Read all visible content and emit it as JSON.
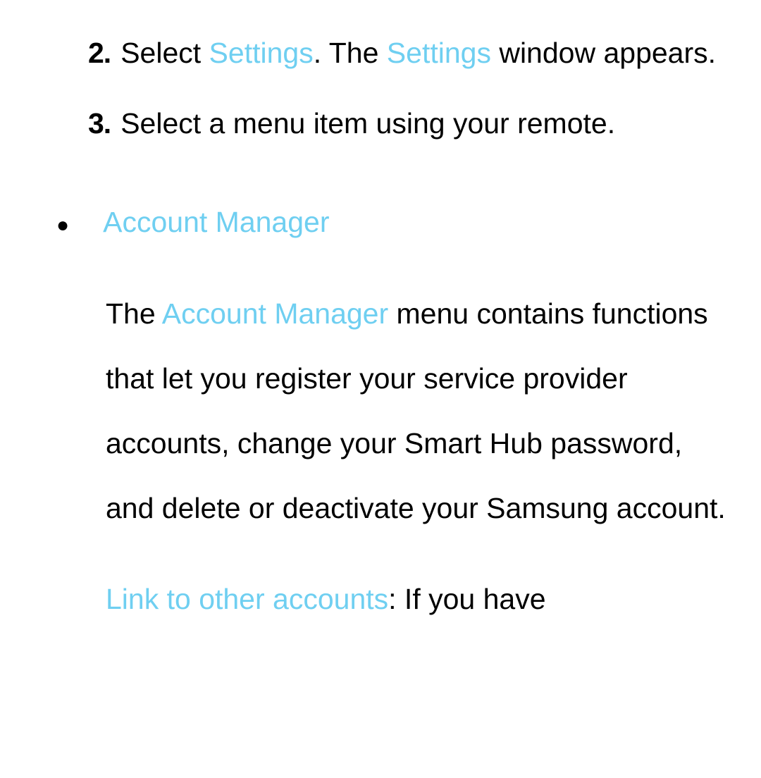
{
  "steps": {
    "item2": {
      "number": "2.",
      "prefix": "Select ",
      "settings1": "Settings",
      "mid": ". The ",
      "settings2": "Settings",
      "suffix": " window appears."
    },
    "item3": {
      "number": "3.",
      "text": "Select a menu item using your remote."
    }
  },
  "section": {
    "bullet": "●",
    "heading": "Account Manager",
    "body": {
      "prefix": "The ",
      "highlight": "Account Manager",
      "suffix": " menu contains functions that let you register your service provider accounts, change your Smart Hub password, and delete or deactivate your Samsung account."
    },
    "body2": {
      "highlight": "Link to other accounts",
      "suffix": ": If you have"
    }
  }
}
